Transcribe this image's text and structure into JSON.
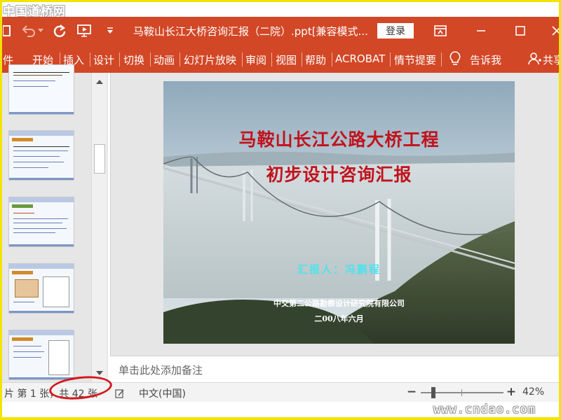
{
  "watermark_top": "中国道桥网",
  "watermark_bottom": "www.cndao.com",
  "titlebar": {
    "document_title": "马鞍山长江大桥咨询汇报（二院）.ppt[兼容模式...",
    "login_label": "登录"
  },
  "ribbon": {
    "tabs": [
      "件",
      "开始",
      "插入",
      "设计",
      "切换",
      "动画",
      "幻灯片放映",
      "审阅",
      "视图",
      "帮助",
      "ACROBAT",
      "情节提要"
    ],
    "tell_me": "告诉我",
    "share": "共享"
  },
  "slide": {
    "title_line1": "马鞍山长江公路大桥工程",
    "title_line2": "初步设计咨询汇报",
    "reporter": "汇报人：冯鹏程",
    "organization": "中交第二公路勘察设计研究院有限公司",
    "date": "二00八年六月"
  },
  "notes": {
    "placeholder": "单击此处添加备注"
  },
  "statusbar": {
    "slide_indicator": "片 第 1 张，共 42 张",
    "language": "中文(中国)",
    "zoom_minus": "−",
    "zoom_plus": "+",
    "zoom_percent": "42%",
    "zoom_level": 42
  },
  "colors": {
    "ribbon": "#d24726",
    "slide_title": "#c1121c",
    "reporter": "#4fe2ee",
    "annotation_circle": "#d5171d",
    "frame": "#f2e300"
  }
}
